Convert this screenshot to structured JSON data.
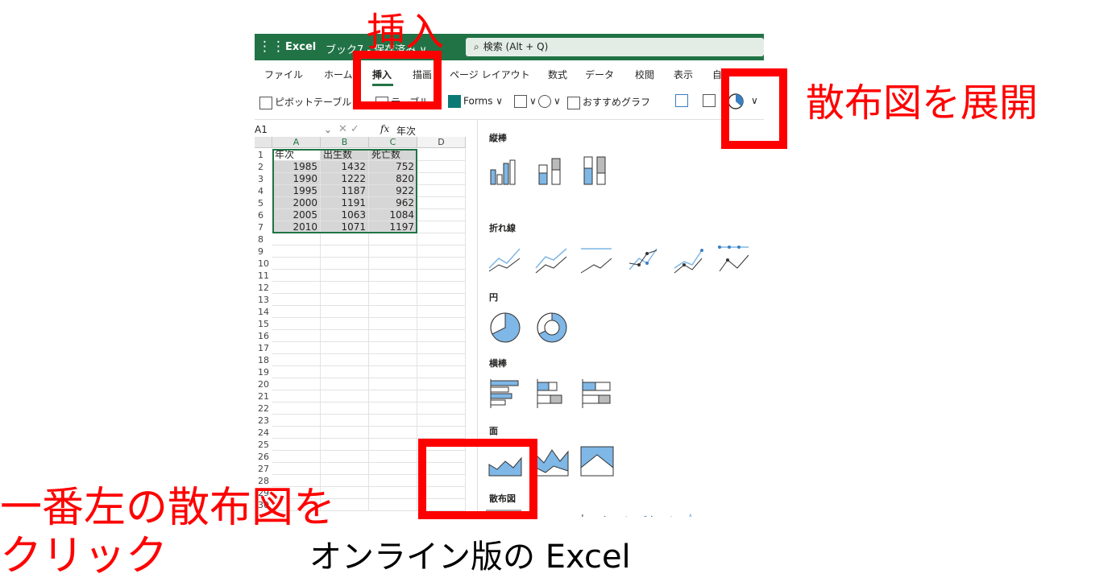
{
  "title_bar": {
    "waffle_icon": "app-launcher-icon",
    "app_name": "Excel",
    "doc_title": "ブック7 - 保存済み ∨",
    "search_placeholder": "検索 (Alt + Q)"
  },
  "ribbon_tabs": [
    "ファイル",
    "ホーム",
    "挿入",
    "描画",
    "ページ レイアウト",
    "数式",
    "データ",
    "校閲",
    "表示",
    "自"
  ],
  "active_tab": "挿入",
  "toolbar": {
    "pivot": "ピボットテーブル ∨",
    "table": "テーブル",
    "forms": "Forms ∨",
    "pictures": "∨",
    "shapes": "∨",
    "recommended": "おすすめグラフ",
    "expand": "∨"
  },
  "formula_bar": {
    "name_box": "A1",
    "fx": "fx",
    "value": "年次"
  },
  "sheet": {
    "columns": [
      "A",
      "B",
      "C",
      "D"
    ],
    "headers": [
      "年次",
      "出生数",
      "死亡数"
    ],
    "rows": [
      [
        "1985",
        "1432",
        "752"
      ],
      [
        "1990",
        "1222",
        "820"
      ],
      [
        "1995",
        "1187",
        "922"
      ],
      [
        "2000",
        "1191",
        "962"
      ],
      [
        "2005",
        "1063",
        "1084"
      ],
      [
        "2010",
        "1071",
        "1197"
      ]
    ],
    "row_numbers": [
      "1",
      "2",
      "3",
      "4",
      "5",
      "6",
      "7",
      "8",
      "9",
      "10",
      "11",
      "12",
      "13",
      "14",
      "15",
      "16",
      "17",
      "18",
      "19",
      "20",
      "21",
      "22",
      "23",
      "24",
      "25",
      "26",
      "27",
      "28",
      "29",
      "30"
    ]
  },
  "gallery": {
    "sections": [
      "縦棒",
      "折れ線",
      "円",
      "横棒",
      "面",
      "散布図"
    ]
  },
  "colors": {
    "excel_green": "#217346",
    "chart_blue": "#7fb7e6",
    "annotation_red": "#ff0000"
  },
  "annotations": {
    "insert": "挿入",
    "expand": "散布図を展開",
    "click_line1": "一番左の散布図を",
    "click_line2": "クリック",
    "caption": "オンライン版の Excel"
  }
}
